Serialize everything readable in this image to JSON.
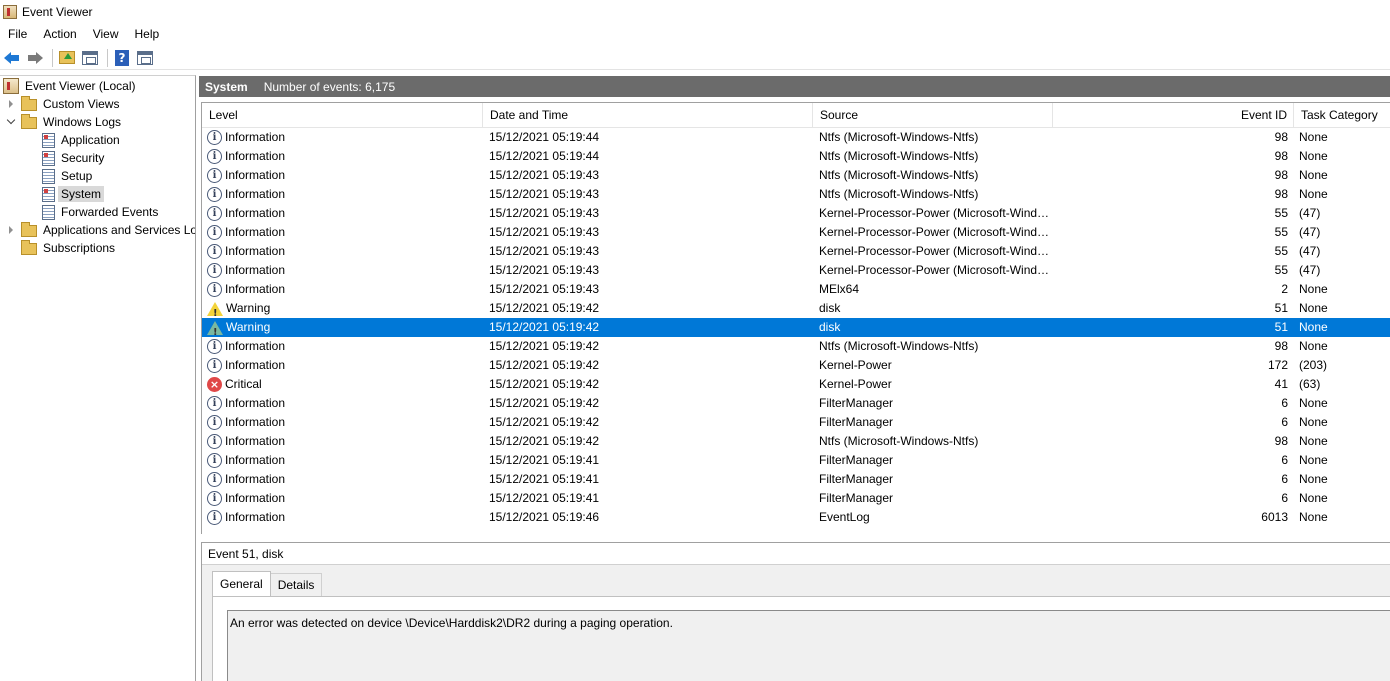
{
  "window": {
    "title": "Event Viewer"
  },
  "menu": [
    "File",
    "Action",
    "View",
    "Help"
  ],
  "toolbar": {
    "icons": [
      "back-arrow-icon",
      "forward-arrow-icon",
      "folder-up-icon",
      "show-hide-tree-icon",
      "help-icon",
      "action-pane-icon"
    ]
  },
  "tree": {
    "root": "Event Viewer (Local)",
    "custom_views": "Custom Views",
    "windows_logs": "Windows Logs",
    "logs": [
      "Application",
      "Security",
      "Setup",
      "System",
      "Forwarded Events"
    ],
    "apps_services": "Applications and Services Logs",
    "subscriptions": "Subscriptions"
  },
  "header": {
    "title": "System",
    "count": "Number of events: 6,175"
  },
  "columns": {
    "level": "Level",
    "date": "Date and Time",
    "source": "Source",
    "event_id": "Event ID",
    "task": "Task Category"
  },
  "rows": [
    {
      "level": "Information",
      "date": "15/12/2021 05:19:44",
      "source": "Ntfs (Microsoft-Windows-Ntfs)",
      "event_id": "98",
      "task": "None"
    },
    {
      "level": "Information",
      "date": "15/12/2021 05:19:44",
      "source": "Ntfs (Microsoft-Windows-Ntfs)",
      "event_id": "98",
      "task": "None"
    },
    {
      "level": "Information",
      "date": "15/12/2021 05:19:43",
      "source": "Ntfs (Microsoft-Windows-Ntfs)",
      "event_id": "98",
      "task": "None"
    },
    {
      "level": "Information",
      "date": "15/12/2021 05:19:43",
      "source": "Ntfs (Microsoft-Windows-Ntfs)",
      "event_id": "98",
      "task": "None"
    },
    {
      "level": "Information",
      "date": "15/12/2021 05:19:43",
      "source": "Kernel-Processor-Power (Microsoft-Wind…",
      "event_id": "55",
      "task": "(47)"
    },
    {
      "level": "Information",
      "date": "15/12/2021 05:19:43",
      "source": "Kernel-Processor-Power (Microsoft-Wind…",
      "event_id": "55",
      "task": "(47)"
    },
    {
      "level": "Information",
      "date": "15/12/2021 05:19:43",
      "source": "Kernel-Processor-Power (Microsoft-Wind…",
      "event_id": "55",
      "task": "(47)"
    },
    {
      "level": "Information",
      "date": "15/12/2021 05:19:43",
      "source": "Kernel-Processor-Power (Microsoft-Wind…",
      "event_id": "55",
      "task": "(47)"
    },
    {
      "level": "Information",
      "date": "15/12/2021 05:19:43",
      "source": "MElx64",
      "event_id": "2",
      "task": "None"
    },
    {
      "level": "Warning",
      "date": "15/12/2021 05:19:42",
      "source": "disk",
      "event_id": "51",
      "task": "None"
    },
    {
      "level": "Warning",
      "date": "15/12/2021 05:19:42",
      "source": "disk",
      "event_id": "51",
      "task": "None",
      "selected": true
    },
    {
      "level": "Information",
      "date": "15/12/2021 05:19:42",
      "source": "Ntfs (Microsoft-Windows-Ntfs)",
      "event_id": "98",
      "task": "None"
    },
    {
      "level": "Information",
      "date": "15/12/2021 05:19:42",
      "source": "Kernel-Power",
      "event_id": "172",
      "task": "(203)"
    },
    {
      "level": "Critical",
      "date": "15/12/2021 05:19:42",
      "source": "Kernel-Power",
      "event_id": "41",
      "task": "(63)"
    },
    {
      "level": "Information",
      "date": "15/12/2021 05:19:42",
      "source": "FilterManager",
      "event_id": "6",
      "task": "None"
    },
    {
      "level": "Information",
      "date": "15/12/2021 05:19:42",
      "source": "FilterManager",
      "event_id": "6",
      "task": "None"
    },
    {
      "level": "Information",
      "date": "15/12/2021 05:19:42",
      "source": "Ntfs (Microsoft-Windows-Ntfs)",
      "event_id": "98",
      "task": "None"
    },
    {
      "level": "Information",
      "date": "15/12/2021 05:19:41",
      "source": "FilterManager",
      "event_id": "6",
      "task": "None"
    },
    {
      "level": "Information",
      "date": "15/12/2021 05:19:41",
      "source": "FilterManager",
      "event_id": "6",
      "task": "None"
    },
    {
      "level": "Information",
      "date": "15/12/2021 05:19:41",
      "source": "FilterManager",
      "event_id": "6",
      "task": "None"
    },
    {
      "level": "Information",
      "date": "15/12/2021 05:19:46",
      "source": "EventLog",
      "event_id": "6013",
      "task": "None"
    }
  ],
  "detail": {
    "title": "Event 51, disk",
    "tabs": [
      "General",
      "Details"
    ],
    "message": "An error was detected on device \\Device\\Harddisk2\\DR2 during a paging operation."
  },
  "colors": {
    "selection": "#0078d7",
    "header_bar": "#6b6b6b"
  }
}
